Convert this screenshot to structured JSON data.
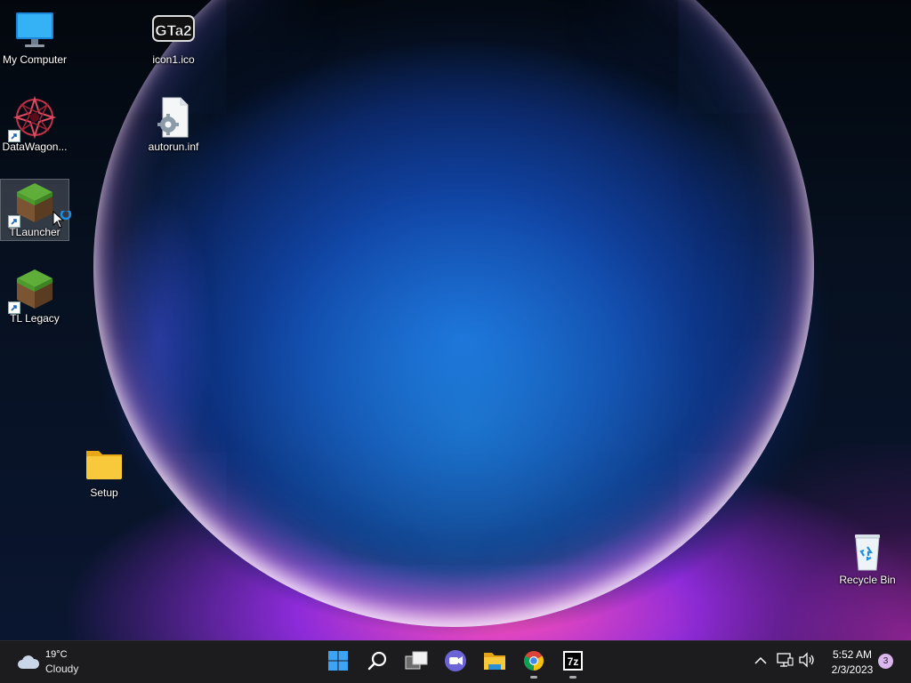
{
  "desktop": {
    "icons": [
      {
        "label": "My Computer",
        "icon": "monitor-icon"
      },
      {
        "label": "icon1.ico",
        "icon": "gta2-logo-icon"
      },
      {
        "label": "DataWagon...",
        "icon": "datawagon-icon",
        "shortcut": true
      },
      {
        "label": "autorun.inf",
        "icon": "settings-file-icon"
      },
      {
        "label": "TLauncher",
        "icon": "minecraft-grass-block-icon",
        "shortcut": true,
        "selected": true
      },
      {
        "label": "TL Legacy",
        "icon": "minecraft-grass-block-icon",
        "shortcut": true
      },
      {
        "label": "Setup",
        "icon": "folder-icon"
      },
      {
        "label": "Recycle Bin",
        "icon": "recycle-bin-icon"
      }
    ],
    "gta2_text": "GTa2"
  },
  "taskbar": {
    "weather": {
      "temperature": "19°C",
      "condition": "Cloudy",
      "icon": "cloudy-icon"
    },
    "apps": [
      {
        "name": "Start",
        "icon": "windows-start-icon"
      },
      {
        "name": "Search",
        "icon": "search-icon"
      },
      {
        "name": "Task View",
        "icon": "task-view-icon"
      },
      {
        "name": "Chat",
        "icon": "teams-chat-icon"
      },
      {
        "name": "File Explorer",
        "icon": "file-explorer-icon"
      },
      {
        "name": "Google Chrome",
        "icon": "chrome-icon",
        "running": true
      },
      {
        "name": "7-Zip",
        "icon": "7zip-icon",
        "running": true
      }
    ],
    "seven_zip_text": "7z",
    "tray": {
      "icons": [
        "chevron-up-icon",
        "network-icon",
        "volume-icon"
      ],
      "time": "5:52 AM",
      "date": "2/3/2023",
      "notifications": "3"
    }
  },
  "colors": {
    "taskbar_bg": "#1c1c1f",
    "start_blue": "#3da3f5",
    "folder_yellow": "#f8c93a"
  }
}
